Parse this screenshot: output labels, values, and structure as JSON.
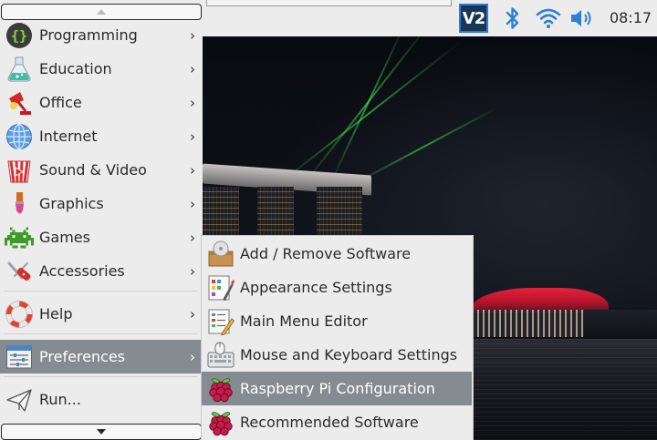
{
  "taskbar": {
    "clock": "08:17",
    "tray_icons": [
      "vnc-icon",
      "bluetooth-icon",
      "wifi-icon",
      "volume-icon"
    ],
    "vnc_label": "V2"
  },
  "main_menu": {
    "items": [
      {
        "label": "Programming",
        "icon": "programming-icon",
        "has_submenu": true
      },
      {
        "label": "Education",
        "icon": "education-icon",
        "has_submenu": true
      },
      {
        "label": "Office",
        "icon": "office-icon",
        "has_submenu": true
      },
      {
        "label": "Internet",
        "icon": "internet-icon",
        "has_submenu": true
      },
      {
        "label": "Sound & Video",
        "icon": "sound-video-icon",
        "has_submenu": true
      },
      {
        "label": "Graphics",
        "icon": "graphics-icon",
        "has_submenu": true
      },
      {
        "label": "Games",
        "icon": "games-icon",
        "has_submenu": true
      },
      {
        "label": "Accessories",
        "icon": "accessories-icon",
        "has_submenu": true
      },
      {
        "label": "Help",
        "icon": "help-icon",
        "has_submenu": true
      },
      {
        "label": "Preferences",
        "icon": "preferences-icon",
        "has_submenu": true,
        "active": true
      },
      {
        "label": "Run...",
        "icon": "run-icon",
        "has_submenu": false
      }
    ]
  },
  "preferences_submenu": {
    "items": [
      {
        "label": "Add / Remove Software",
        "icon": "package-icon"
      },
      {
        "label": "Appearance Settings",
        "icon": "appearance-icon"
      },
      {
        "label": "Main Menu Editor",
        "icon": "menu-editor-icon"
      },
      {
        "label": "Mouse and Keyboard Settings",
        "icon": "mouse-keyboard-icon"
      },
      {
        "label": "Raspberry Pi Configuration",
        "icon": "raspberry-icon",
        "active": true
      },
      {
        "label": "Recommended Software",
        "icon": "raspberry-icon"
      }
    ]
  },
  "colors": {
    "menu_background": "#ececec",
    "highlight": "#848c91",
    "raspberry_red": "#c51a4a",
    "leaf_green": "#6cc04a"
  }
}
